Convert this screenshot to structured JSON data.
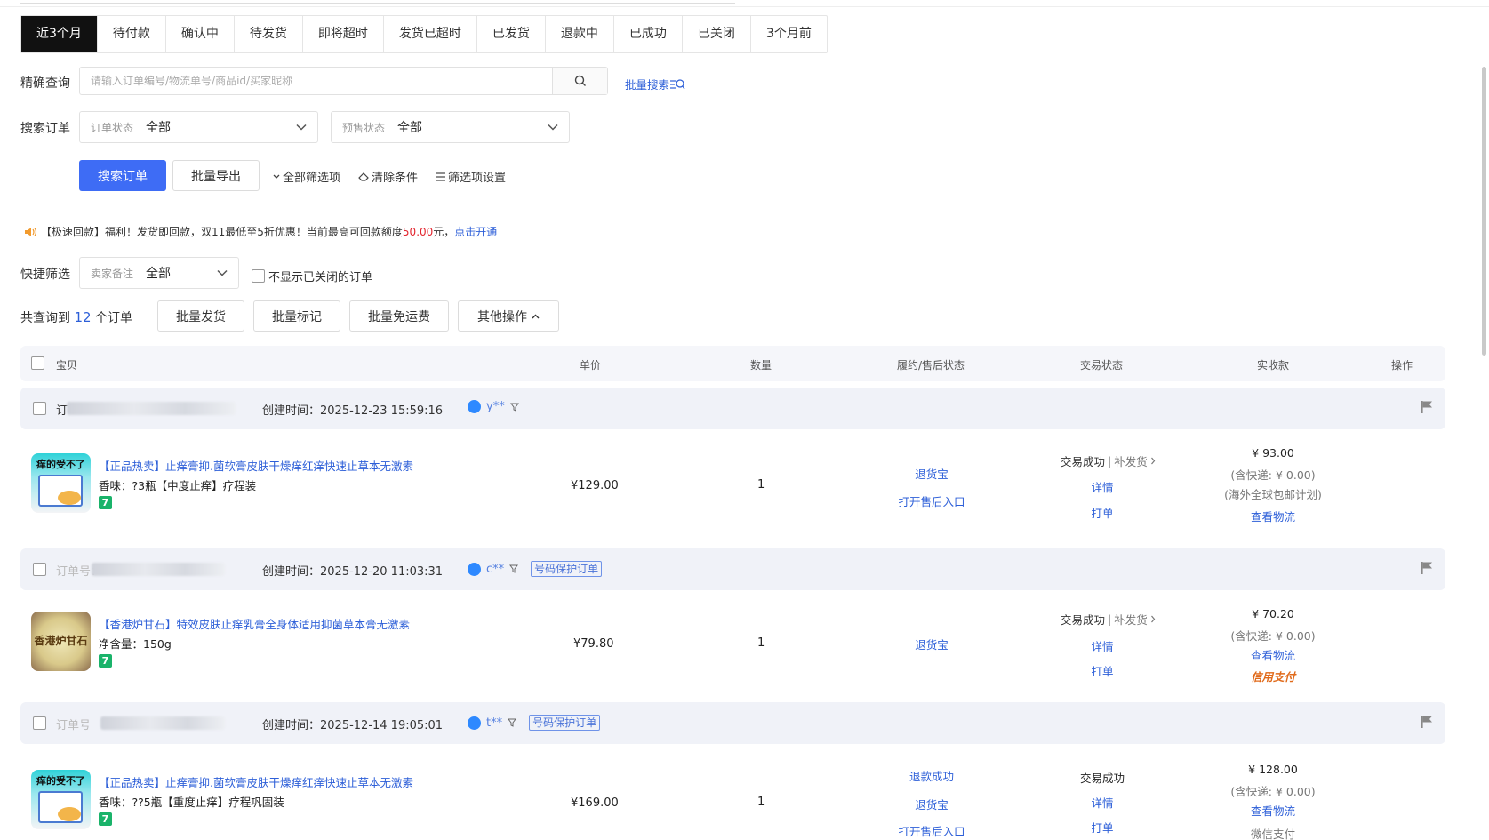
{
  "tabs": [
    {
      "label": "近3个月",
      "active": true
    },
    {
      "label": "待付款"
    },
    {
      "label": "确认中"
    },
    {
      "label": "待发货"
    },
    {
      "label": "即将超时"
    },
    {
      "label": "发货已超时"
    },
    {
      "label": "已发货"
    },
    {
      "label": "退款中"
    },
    {
      "label": "已成功"
    },
    {
      "label": "已关闭"
    },
    {
      "label": "3个月前"
    }
  ],
  "search": {
    "label": "精确查询",
    "placeholder": "请输入订单编号/物流单号/商品id/买家昵称",
    "batch_link": "批量搜索"
  },
  "filters": {
    "label": "搜索订单",
    "order_status_label": "订单状态",
    "order_status_value": "全部",
    "presale_label": "预售状态",
    "presale_value": "全部"
  },
  "actions": {
    "search_btn": "搜索订单",
    "export_btn": "批量导出",
    "all_filters": "全部筛选项",
    "clear": "清除条件",
    "settings": "筛选项设置"
  },
  "notice": {
    "text1": "【极速回款】福利！发货即回款，双11最低至5折优惠！当前最高可回款额度",
    "amount": "50.00",
    "text2": "元，",
    "link": "点击开通"
  },
  "quick": {
    "label": "快捷筛选",
    "remark_label": "卖家备注",
    "remark_value": "全部",
    "hide_closed": "不显示已关闭的订单"
  },
  "summary": {
    "prefix": "共查询到",
    "count": "12",
    "suffix": "个订单",
    "btn_ship": "批量发货",
    "btn_mark": "批量标记",
    "btn_freeship": "批量免运费",
    "btn_more": "其他操作"
  },
  "columns": {
    "item": "宝贝",
    "price": "单价",
    "qty": "数量",
    "after_sale": "履约/售后状态",
    "trade_status": "交易状态",
    "paid": "实收款",
    "ops": "操作"
  },
  "orders": [
    {
      "order_no_label": "订",
      "created": "创建时间：2025-12-23 15:59:16",
      "buyer": "y**",
      "thumb_text": "痒的受不了",
      "title": "【正品热卖】止痒膏抑.菌软膏皮肤干燥痒红痒快速止草本无激素",
      "spec": "香味：?3瓶【中度止痒】疗程装",
      "price": "¥129.00",
      "qty": "1",
      "after": [
        "退货宝",
        "打开售后入口"
      ],
      "status": "交易成功",
      "status_extra": "补发货",
      "details": "详情",
      "print": "打单",
      "paid": "¥ 93.00",
      "shipping": "(含快递: ¥ 0.00)",
      "plan": "(海外全球包邮计划)",
      "logistics": "查看物流"
    },
    {
      "order_no_label": "订单号：",
      "created": "创建时间：2025-12-20 11:03:31",
      "buyer": "c**",
      "badge": "号码保护订单",
      "thumb_text": "香港炉甘石",
      "title": "【香港炉甘石】特效皮肤止痒乳膏全身体适用抑菌草本膏无激素",
      "spec": "净含量：150g",
      "price": "¥79.80",
      "qty": "1",
      "after": [
        "退货宝"
      ],
      "status": "交易成功",
      "status_extra": "补发货",
      "details": "详情",
      "print": "打单",
      "paid": "¥ 70.20",
      "shipping": "(含快递: ¥ 0.00)",
      "logistics": "查看物流",
      "pay_method": "信用支付"
    },
    {
      "order_no_label": "订单号",
      "created": "创建时间：2025-12-14 19:05:01",
      "buyer": "t**",
      "badge": "号码保护订单",
      "thumb_text": "痒的受不了",
      "title": "【正品热卖】止痒膏抑.菌软膏皮肤干燥痒红痒快速止草本无激素",
      "spec": "香味：??5瓶【重度止痒】疗程巩固装",
      "price": "¥169.00",
      "qty": "1",
      "after": [
        "退款成功",
        "退货宝",
        "打开售后入口"
      ],
      "status": "交易成功",
      "details": "详情",
      "print": "打单",
      "paid": "¥ 128.00",
      "shipping": "(含快递: ¥ 0.00)",
      "logistics": "查看物流",
      "pay_method": "微信支付"
    }
  ],
  "colors": {
    "primary": "#3e6cf5",
    "link": "#2d5fd8",
    "active_tab": "#111111",
    "amount_red": "#e3262f"
  }
}
